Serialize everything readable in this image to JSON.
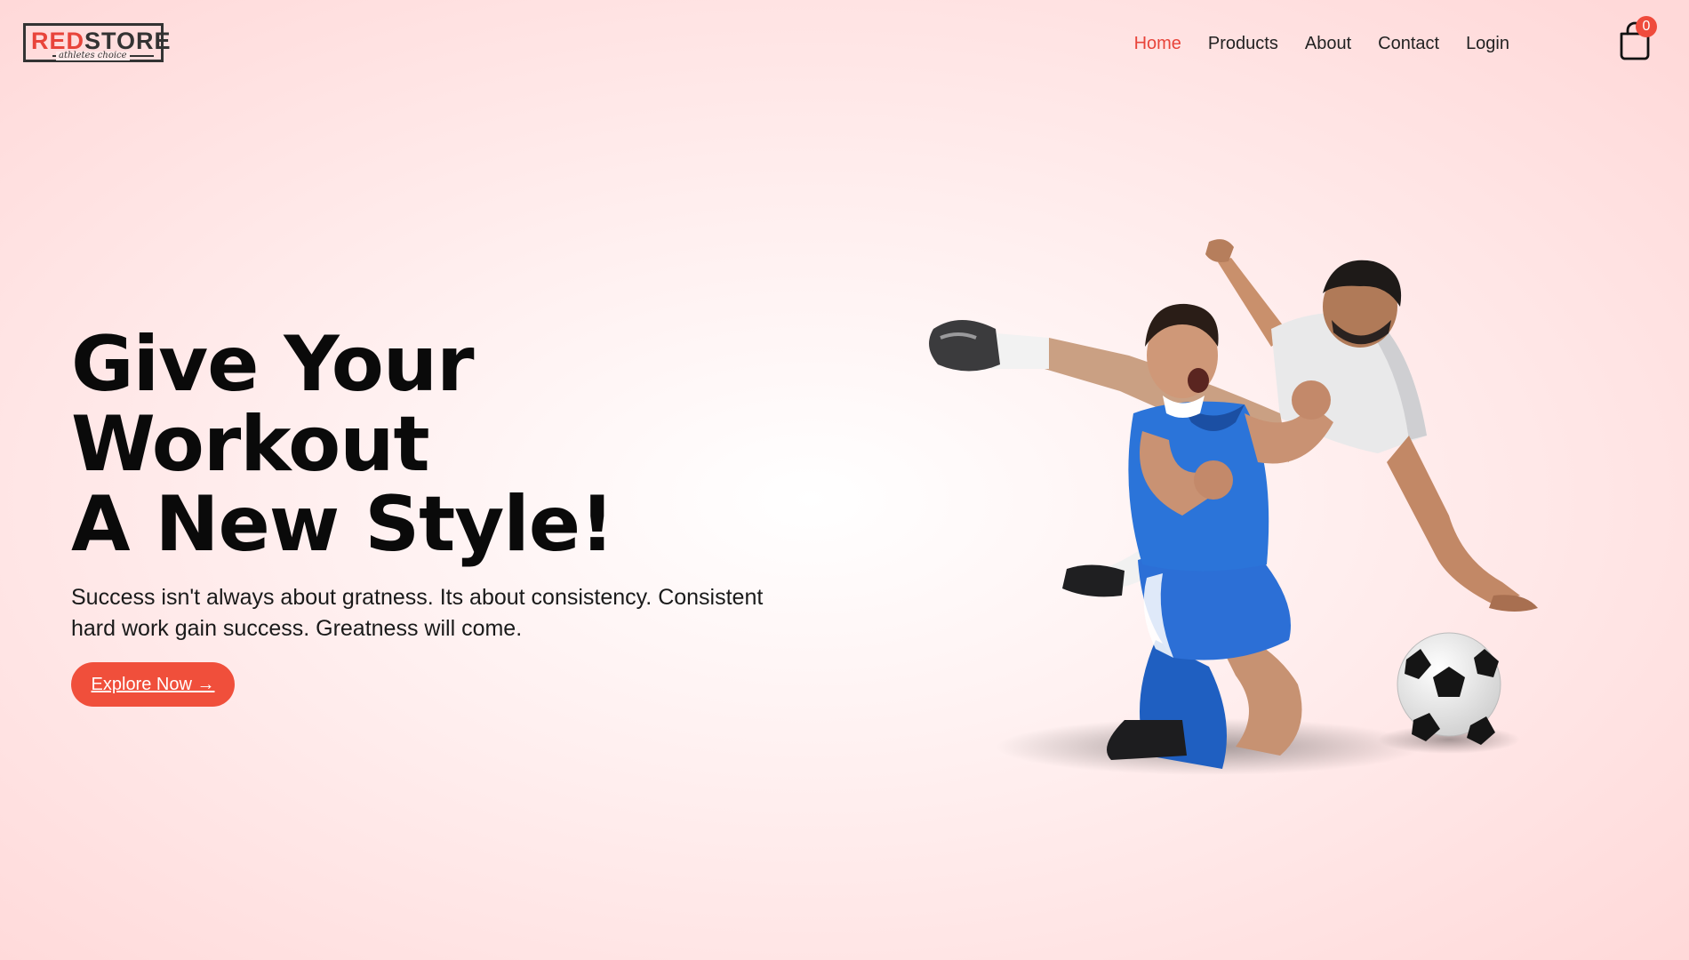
{
  "brand": {
    "logo_red": "RED",
    "logo_dark": "STORE",
    "tagline": "athletes choice"
  },
  "nav": {
    "items": [
      {
        "label": "Home",
        "active": true
      },
      {
        "label": "Products",
        "active": false
      },
      {
        "label": "About",
        "active": false
      },
      {
        "label": "Contact",
        "active": false
      },
      {
        "label": "Login",
        "active": false
      }
    ]
  },
  "cart": {
    "icon": "shopping-bag-icon",
    "count": "0"
  },
  "hero": {
    "title_line1": "Give Your",
    "title_line2": "Workout",
    "title_line3": "A New Style!",
    "description": "Success isn't always about gratness. Its about consistency. Consistent hard work gain success. Greatness will come.",
    "button_label": "Explore Now →"
  },
  "colors": {
    "accent": "#ef4b3c",
    "text": "#111111",
    "background_edge": "#ffd9d9"
  }
}
